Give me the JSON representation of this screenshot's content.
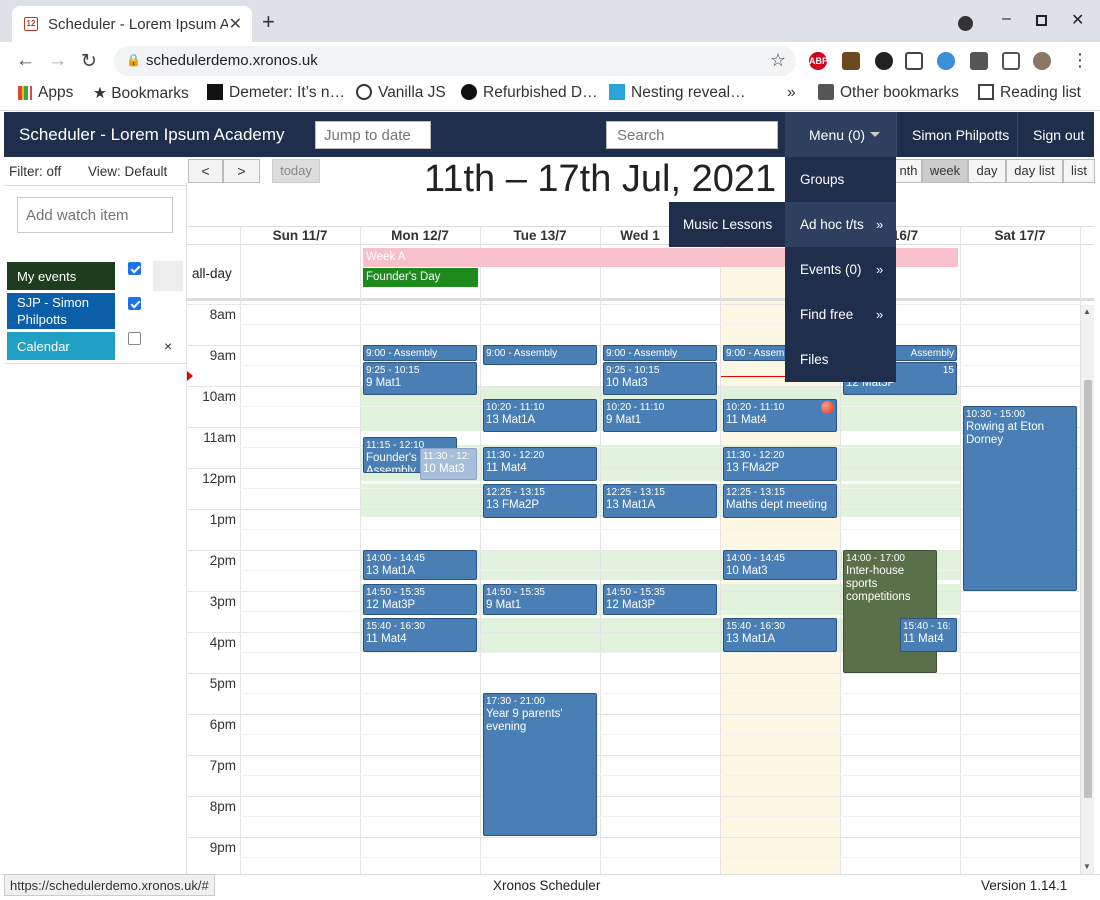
{
  "browser": {
    "tab_title": "Scheduler - Lorem Ipsum Academy",
    "url": "schedulerdemo.xronos.uk",
    "bookmarks": [
      "Apps",
      "Bookmarks",
      "Demeter: It’s n…",
      "Vanilla JS",
      "Refurbished D…",
      "Nesting reveal…"
    ],
    "other_bookmarks": "Other bookmarks",
    "reading_list": "Reading list",
    "chevron": "»"
  },
  "app": {
    "title": "Scheduler - Lorem Ipsum Academy",
    "jump_placeholder": "Jump to date",
    "search_placeholder": "Search",
    "menu_label": "Menu (0)",
    "user_name": "Simon Philpotts",
    "sign_out": "Sign out"
  },
  "menu": {
    "items": [
      {
        "label": "Groups",
        "arrow": ""
      },
      {
        "label": "Ad hoc t/ts",
        "arrow": "»"
      },
      {
        "label": "Events (0)",
        "arrow": "»"
      },
      {
        "label": "Find free",
        "arrow": "»"
      },
      {
        "label": "Files",
        "arrow": ""
      }
    ],
    "submenu_item": "Music Lessons"
  },
  "sidebar": {
    "filter": "Filter: off",
    "view": "View: Default",
    "watch_placeholder": "Add watch item",
    "calendars": [
      {
        "label": "My events",
        "color": "#1e3d1e",
        "checked": true
      },
      {
        "label": "SJP - Simon Philpotts",
        "color": "#0b5ea8",
        "checked": true
      },
      {
        "label": "Calendar",
        "color": "#1fa0c4",
        "checked": false
      }
    ],
    "remove": "×"
  },
  "calendar": {
    "prev": "<",
    "next": ">",
    "today": "today",
    "range_title": "11th – 17th Jul, 2021",
    "views": [
      "nth",
      "week",
      "day",
      "day list",
      "list"
    ],
    "active_view": "week",
    "days": [
      "Sun 11/7",
      "Mon 12/7",
      "Tue 13/7",
      "Wed 1",
      "",
      "16/7",
      "Sat 17/7"
    ],
    "allday_label": "all-day",
    "hours": [
      "8am",
      "9am",
      "10am",
      "11am",
      "12pm",
      "1pm",
      "2pm",
      "3pm",
      "4pm",
      "5pm",
      "6pm",
      "7pm",
      "8pm",
      "9pm"
    ],
    "allday_events": [
      {
        "label": "Week A",
        "color": "#f7c0cb"
      },
      {
        "label": "Founder's Day",
        "color": "#1e8a1e"
      }
    ],
    "events": {
      "mon": [
        {
          "time": "9:00 - Assembly",
          "name": ""
        },
        {
          "time": "9:25 - 10:15",
          "name": "9 Mat1"
        },
        {
          "time": "11:15 - 12:10",
          "name": "Founder's Day Assembly"
        },
        {
          "time": "11:30 - 12:",
          "name": "10 Mat3"
        },
        {
          "time": "14:00 - 14:45",
          "name": "13 Mat1A"
        },
        {
          "time": "14:50 - 15:35",
          "name": "12 Mat3P"
        },
        {
          "time": "15:40 - 16:30",
          "name": "11 Mat4"
        }
      ],
      "tue": [
        {
          "time": "9:00 - Assembly",
          "name": ""
        },
        {
          "time": "10:20 - 11:10",
          "name": "13 Mat1A"
        },
        {
          "time": "11:30 - 12:20",
          "name": "11 Mat4"
        },
        {
          "time": "12:25 - 13:15",
          "name": "13 FMa2P"
        },
        {
          "time": "14:50 - 15:35",
          "name": "9 Mat1"
        },
        {
          "time": "17:30 - 21:00",
          "name": "Year 9 parents' evening"
        }
      ],
      "wed": [
        {
          "time": "9:00 - Assembly",
          "name": ""
        },
        {
          "time": "9:25 - 10:15",
          "name": "10 Mat3"
        },
        {
          "time": "10:20 - 11:10",
          "name": "9 Mat1"
        },
        {
          "time": "12:25 - 13:15",
          "name": "13 Mat1A"
        },
        {
          "time": "14:50 - 15:35",
          "name": "12 Mat3P"
        }
      ],
      "thu": [
        {
          "time": "9:00 - Assem",
          "name": ""
        },
        {
          "time": "10:20 - 11:10",
          "name": "11 Mat4"
        },
        {
          "time": "11:30 - 12:20",
          "name": "13 FMa2P"
        },
        {
          "time": "12:25 - 13:15",
          "name": "Maths dept meeting"
        },
        {
          "time": "14:00 - 14:45",
          "name": "10 Mat3"
        },
        {
          "time": "15:40 - 16:30",
          "name": "13 Mat1A"
        }
      ],
      "fri": [
        {
          "time": "Assembly",
          "name": ""
        },
        {
          "time": "15",
          "name": "12 Mat3P"
        },
        {
          "time": "14:00 - 17:00",
          "name": "Inter-house sports competitions"
        },
        {
          "time": "15:40 - 16:",
          "name": "11 Mat4"
        }
      ],
      "sat": [
        {
          "time": "10:30 - 15:00",
          "name": "Rowing at Eton Dorney"
        }
      ]
    }
  },
  "footer": {
    "hover_url": "https://schedulerdemo.xronos.uk/#",
    "center": "Xronos Scheduler",
    "version": "Version 1.14.1"
  }
}
